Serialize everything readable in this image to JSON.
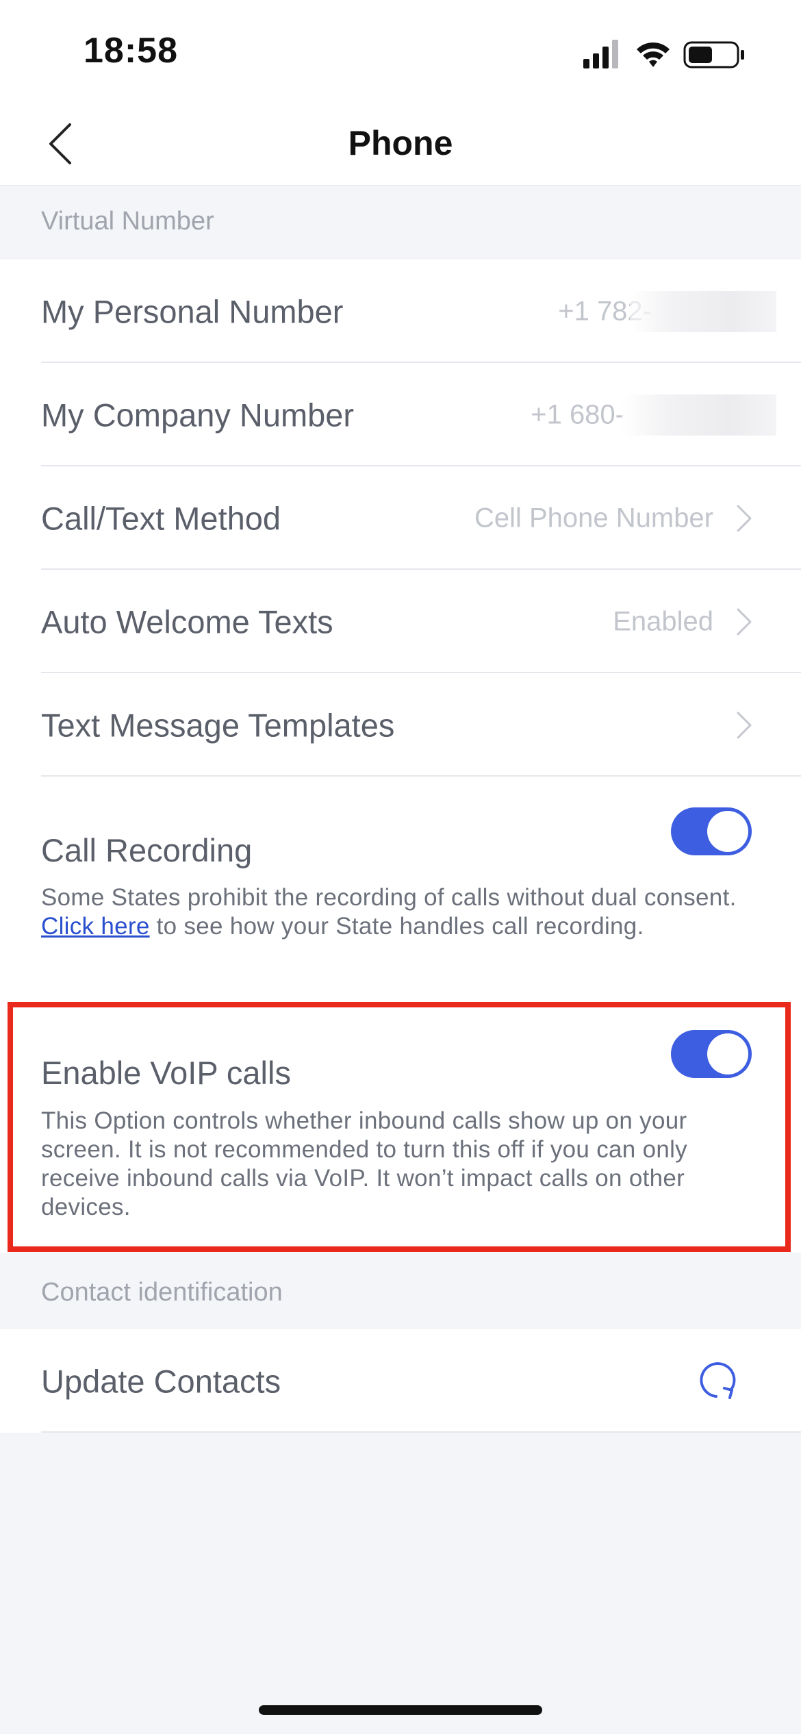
{
  "status_bar": {
    "time": "18:58",
    "icons": [
      "cellular-signal-icon",
      "wifi-icon",
      "battery-icon"
    ]
  },
  "nav": {
    "title": "Phone",
    "back_icon": "chevron-left-icon"
  },
  "sections": {
    "virtual_number": {
      "header": "Virtual Number",
      "personal_number": {
        "label": "My Personal Number",
        "value": "+1 782-"
      },
      "company_number": {
        "label": "My Company Number",
        "value": "+1 680-"
      },
      "call_text_method": {
        "label": "Call/Text Method",
        "value": "Cell Phone Number"
      },
      "auto_welcome_texts": {
        "label": "Auto Welcome Texts",
        "value": "Enabled"
      },
      "text_message_templates": {
        "label": "Text Message Templates"
      },
      "call_recording": {
        "label": "Call Recording",
        "enabled": true,
        "desc_before": "Some States prohibit the recording of calls without dual consent. ",
        "desc_link": "Click here",
        "desc_after": " to see how your State handles call recording."
      },
      "enable_voip": {
        "label": "Enable VoIP calls",
        "enabled": true,
        "desc": "This Option controls whether inbound calls show up on your screen. It is not recommended to turn this off if you can only receive inbound calls via VoIP. It won’t impact calls on other devices."
      }
    },
    "contact_identification": {
      "header": "Contact identification",
      "update_contacts": {
        "label": "Update Contacts",
        "icon": "refresh-icon"
      }
    }
  },
  "colors": {
    "accent": "#3d5ee0",
    "link": "#2a4fcf",
    "highlight": "#e8291c",
    "background": "#f4f5f9"
  }
}
